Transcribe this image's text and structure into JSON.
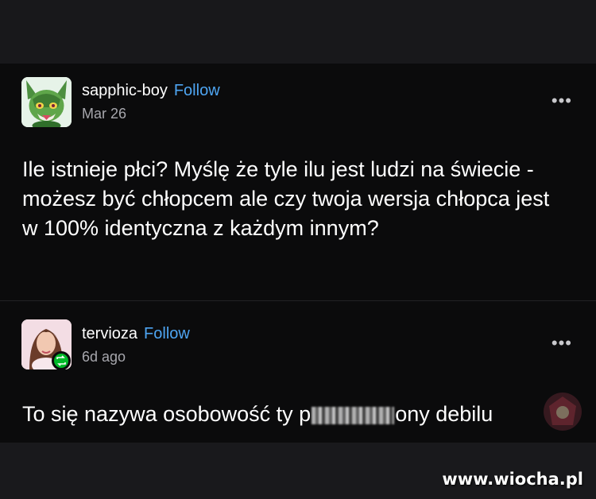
{
  "posts": [
    {
      "username": "sapphic-boy",
      "follow_label": "Follow",
      "date": "Mar 26",
      "more_label": "•••",
      "avatar_icon": "green-cat-creature-avatar",
      "text": "Ile istnieje płci? Myślę że tyle ilu jest ludzi na świecie - możesz być chłopcem ale czy twoja wersja chłopca jest w 100% identyczna z każdym innym?"
    },
    {
      "username": "tervioza",
      "follow_label": "Follow",
      "date": "6d ago",
      "more_label": "•••",
      "avatar_icon": "woman-portrait-avatar",
      "reblog_icon": "reblog-icon",
      "text_before": "To się nazywa osobowość ty p",
      "text_after": "ony debilu"
    }
  ],
  "watermark": "www.wiocha.pl",
  "colors": {
    "background": "#0b0b0c",
    "follow": "#4ea5f2",
    "reblog_badge": "#00b929",
    "meta_text": "#a7a7ad"
  }
}
